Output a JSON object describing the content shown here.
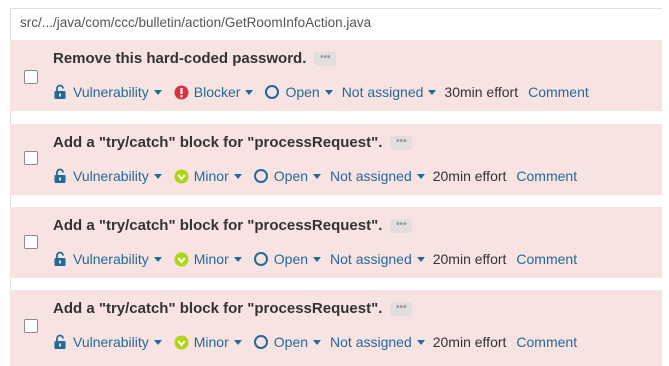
{
  "file_path": "src/.../java/com/ccc/bulletin/action/GetRoomInfoAction.java",
  "issues": [
    {
      "title": "Remove this hard-coded password.",
      "more_label": "•••",
      "type": "Vulnerability",
      "severity": "Blocker",
      "severity_icon": "blocker-icon",
      "status": "Open",
      "assignee": "Not assigned",
      "effort": "30min effort",
      "comment": "Comment"
    },
    {
      "title": "Add a \"try/catch\" block for \"processRequest\".",
      "more_label": "•••",
      "type": "Vulnerability",
      "severity": "Minor",
      "severity_icon": "minor-icon",
      "status": "Open",
      "assignee": "Not assigned",
      "effort": "20min effort",
      "comment": "Comment"
    },
    {
      "title": "Add a \"try/catch\" block for \"processRequest\".",
      "more_label": "•••",
      "type": "Vulnerability",
      "severity": "Minor",
      "severity_icon": "minor-icon",
      "status": "Open",
      "assignee": "Not assigned",
      "effort": "20min effort",
      "comment": "Comment"
    },
    {
      "title": "Add a \"try/catch\" block for \"processRequest\".",
      "more_label": "•••",
      "type": "Vulnerability",
      "severity": "Minor",
      "severity_icon": "minor-icon",
      "status": "Open",
      "assignee": "Not assigned",
      "effort": "20min effort",
      "comment": "Comment"
    }
  ],
  "colors": {
    "issue_bg": "#f8e3e3",
    "link": "#236a97",
    "blocker": "#d4333f",
    "minor": "#b0d513"
  }
}
